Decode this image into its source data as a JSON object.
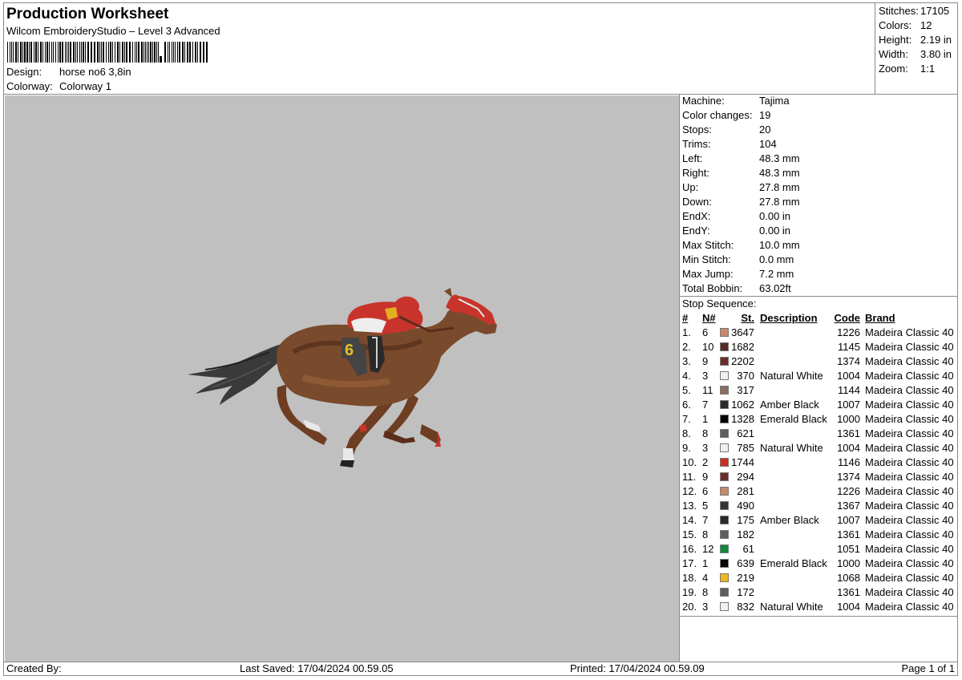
{
  "header": {
    "title": "Production Worksheet",
    "subtitle": "Wilcom EmbroideryStudio – Level 3 Advanced",
    "design_label": "Design:",
    "design_value": "horse no6  3,8in",
    "colorway_label": "Colorway:",
    "colorway_value": "Colorway 1"
  },
  "stats": [
    {
      "label": "Stitches:",
      "value": "17105"
    },
    {
      "label": "Colors:",
      "value": "12"
    },
    {
      "label": "Height:",
      "value": "2.19 in"
    },
    {
      "label": "Width:",
      "value": "3.80 in"
    },
    {
      "label": "Zoom:",
      "value": "1:1"
    }
  ],
  "machine": [
    {
      "label": "Machine:",
      "value": "Tajima"
    },
    {
      "label": "Color changes:",
      "value": "19"
    },
    {
      "label": "Stops:",
      "value": "20"
    },
    {
      "label": "Trims:",
      "value": "104"
    },
    {
      "label": "Left:",
      "value": "48.3 mm"
    },
    {
      "label": "Right:",
      "value": "48.3 mm"
    },
    {
      "label": "Up:",
      "value": "27.8 mm"
    },
    {
      "label": "Down:",
      "value": "27.8 mm"
    },
    {
      "label": "EndX:",
      "value": "0.00 in"
    },
    {
      "label": "EndY:",
      "value": "0.00 in"
    },
    {
      "label": "Max Stitch:",
      "value": "10.0 mm"
    },
    {
      "label": "Min Stitch:",
      "value": "0.0 mm"
    },
    {
      "label": "Max Jump:",
      "value": "7.2 mm"
    },
    {
      "label": "Total Bobbin:",
      "value": "63.02ft"
    }
  ],
  "stop_sequence": {
    "label": "Stop Sequence:",
    "columns": {
      "idx": "#",
      "n": "N#",
      "st": "St.",
      "desc": "Description",
      "code": "Code",
      "brand": "Brand"
    },
    "rows": [
      {
        "idx": "1.",
        "n": "6",
        "color": "#c8896a",
        "st": "3647",
        "desc": "",
        "code": "1226",
        "brand": "Madeira Classic 40"
      },
      {
        "idx": "2.",
        "n": "10",
        "color": "#5b2a24",
        "st": "1682",
        "desc": "",
        "code": "1145",
        "brand": "Madeira Classic 40"
      },
      {
        "idx": "3.",
        "n": "9",
        "color": "#6e2b2a",
        "st": "2202",
        "desc": "",
        "code": "1374",
        "brand": "Madeira Classic 40"
      },
      {
        "idx": "4.",
        "n": "3",
        "color": "#f0f0f4",
        "st": "370",
        "desc": "Natural White",
        "code": "1004",
        "brand": "Madeira Classic 40"
      },
      {
        "idx": "5.",
        "n": "11",
        "color": "#8a6e5e",
        "st": "317",
        "desc": "",
        "code": "1144",
        "brand": "Madeira Classic 40"
      },
      {
        "idx": "6.",
        "n": "7",
        "color": "#2a2a2a",
        "st": "1062",
        "desc": "Amber Black",
        "code": "1007",
        "brand": "Madeira Classic 40"
      },
      {
        "idx": "7.",
        "n": "1",
        "color": "#060606",
        "st": "1328",
        "desc": "Emerald Black",
        "code": "1000",
        "brand": "Madeira Classic 40"
      },
      {
        "idx": "8.",
        "n": "8",
        "color": "#5e5e5e",
        "st": "621",
        "desc": "",
        "code": "1361",
        "brand": "Madeira Classic 40"
      },
      {
        "idx": "9.",
        "n": "3",
        "color": "#f0f0f4",
        "st": "785",
        "desc": "Natural White",
        "code": "1004",
        "brand": "Madeira Classic 40"
      },
      {
        "idx": "10.",
        "n": "2",
        "color": "#d42a22",
        "st": "1744",
        "desc": "",
        "code": "1146",
        "brand": "Madeira Classic 40"
      },
      {
        "idx": "11.",
        "n": "9",
        "color": "#6e2b2a",
        "st": "294",
        "desc": "",
        "code": "1374",
        "brand": "Madeira Classic 40"
      },
      {
        "idx": "12.",
        "n": "6",
        "color": "#c8896a",
        "st": "281",
        "desc": "",
        "code": "1226",
        "brand": "Madeira Classic 40"
      },
      {
        "idx": "13.",
        "n": "5",
        "color": "#333333",
        "st": "490",
        "desc": "",
        "code": "1367",
        "brand": "Madeira Classic 40"
      },
      {
        "idx": "14.",
        "n": "7",
        "color": "#2a2a2a",
        "st": "175",
        "desc": "Amber Black",
        "code": "1007",
        "brand": "Madeira Classic 40"
      },
      {
        "idx": "15.",
        "n": "8",
        "color": "#5e5e5e",
        "st": "182",
        "desc": "",
        "code": "1361",
        "brand": "Madeira Classic 40"
      },
      {
        "idx": "16.",
        "n": "12",
        "color": "#0e8a3c",
        "st": "61",
        "desc": "",
        "code": "1051",
        "brand": "Madeira Classic 40"
      },
      {
        "idx": "17.",
        "n": "1",
        "color": "#060606",
        "st": "639",
        "desc": "Emerald Black",
        "code": "1000",
        "brand": "Madeira Classic 40"
      },
      {
        "idx": "18.",
        "n": "4",
        "color": "#f2b817",
        "st": "219",
        "desc": "",
        "code": "1068",
        "brand": "Madeira Classic 40"
      },
      {
        "idx": "19.",
        "n": "8",
        "color": "#5e5e5e",
        "st": "172",
        "desc": "",
        "code": "1361",
        "brand": "Madeira Classic 40"
      },
      {
        "idx": "20.",
        "n": "3",
        "color": "#f0f0f4",
        "st": "832",
        "desc": "Natural White",
        "code": "1004",
        "brand": "Madeira Classic 40"
      }
    ]
  },
  "footer": {
    "created_by": "Created By:",
    "last_saved": "Last Saved: 17/04/2024 00.59.05",
    "printed": "Printed: 17/04/2024 00.59.09",
    "page": "Page 1 of 1"
  },
  "design_preview": {
    "bib_number": "6",
    "colors": {
      "background": "#c0c0c0",
      "horse": "#7a4a2c",
      "silks": "#c8342b",
      "tail": "#333333",
      "bib": "#e8c020"
    }
  }
}
